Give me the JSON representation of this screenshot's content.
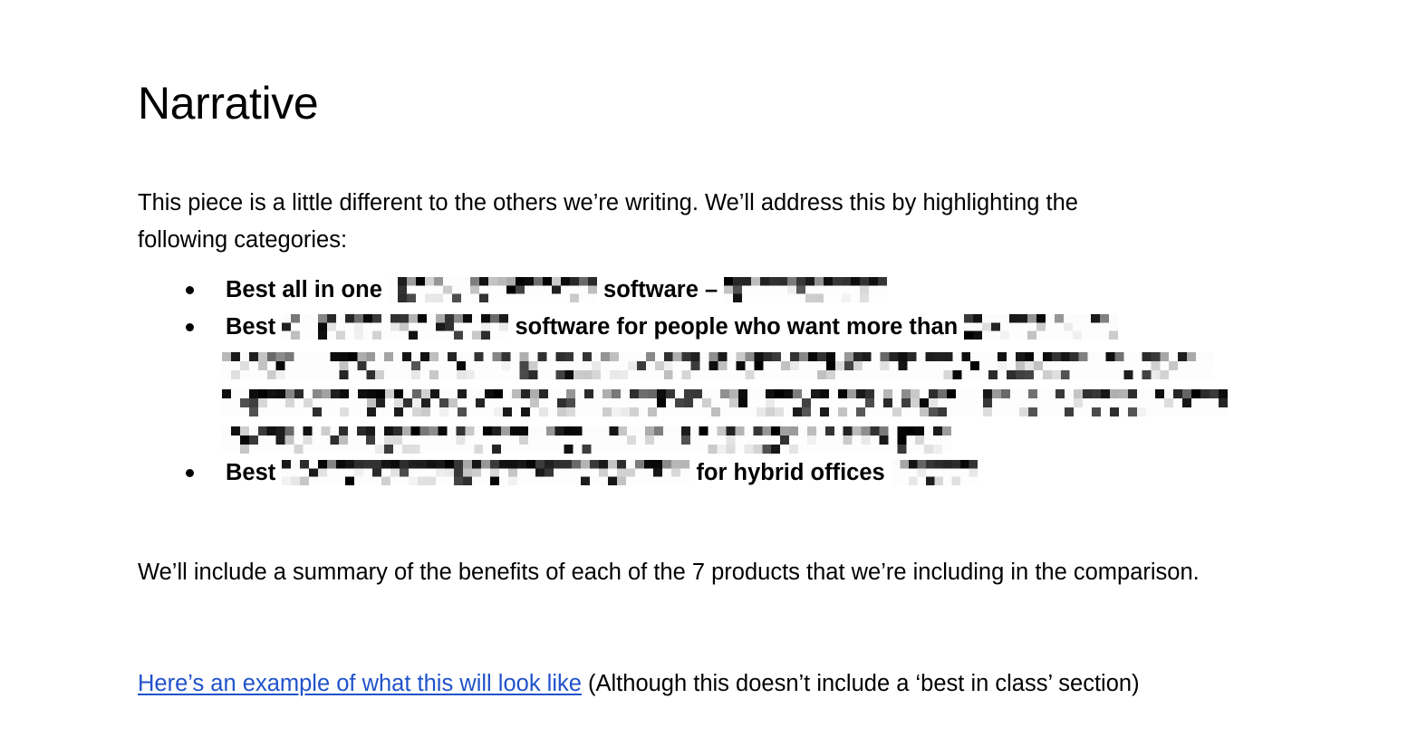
{
  "document": {
    "title": "Narrative",
    "background_color": "#ffffff",
    "text_color": "#000000",
    "link_color": "#2052c9"
  },
  "intro": {
    "text": "This piece is a little different to the others we’re writing. We’ll address this by highlighting the following categories:"
  },
  "bullets": [
    {
      "prefix": "Best all in one ",
      "redacted_1": "█████████████",
      "middle": " software – ",
      "redacted_2": "██████████",
      "suffix": ""
    },
    {
      "prefix": "Best ",
      "redacted_1": "██████████",
      "middle": " software for people who want more than ",
      "redacted_2": "████████",
      "suffix": ""
    },
    {
      "prefix": "Best ",
      "redacted_1": "██████████████████",
      "middle": " for hybrid offices ",
      "redacted_2": "████",
      "suffix": ""
    }
  ],
  "redacted_block": {
    "line_1": "██████████████████████████████████████",
    "line_2": "██████████████████████████████████████",
    "line_3": "███████████████████████████"
  },
  "summary": {
    "text": "We’ll include a summary of the benefits of each of the 7 products that we’re including in the comparison."
  },
  "link_paragraph": {
    "link_text": "Here’s an example of what this will look like",
    "trailing_text": " (Although this doesn’t include a ‘best in class’ section)"
  }
}
